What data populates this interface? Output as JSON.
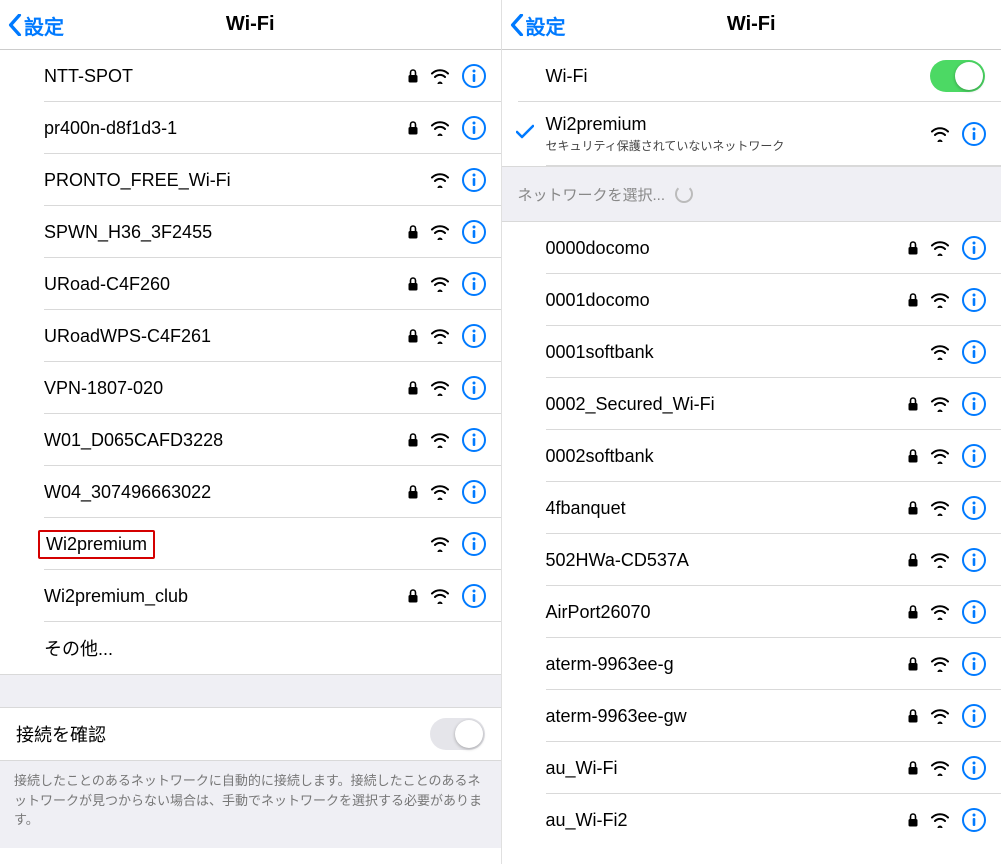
{
  "left": {
    "back_label": "設定",
    "title": "Wi-Fi",
    "networks": [
      {
        "name": "NTT-SPOT",
        "locked": true
      },
      {
        "name": "pr400n-d8f1d3-1",
        "locked": true
      },
      {
        "name": "PRONTO_FREE_Wi-Fi",
        "locked": false
      },
      {
        "name": "SPWN_H36_3F2455",
        "locked": true
      },
      {
        "name": "URoad-C4F260",
        "locked": true
      },
      {
        "name": "URoadWPS-C4F261",
        "locked": true
      },
      {
        "name": "VPN-1807-020",
        "locked": true
      },
      {
        "name": "W01_D065CAFD3228",
        "locked": true
      },
      {
        "name": "W04_307496663022",
        "locked": true
      },
      {
        "name": "Wi2premium",
        "locked": false,
        "highlighted": true
      },
      {
        "name": "Wi2premium_club",
        "locked": true
      },
      {
        "name": "その他...",
        "other": true
      }
    ],
    "ask_to_join_label": "接続を確認",
    "ask_to_join_on": false,
    "footer_text": "接続したことのあるネットワークに自動的に接続します。接続したことのあるネットワークが見つからない場合は、手動でネットワークを選択する必要があります。"
  },
  "right": {
    "back_label": "設定",
    "title": "Wi-Fi",
    "wifi_label": "Wi-Fi",
    "wifi_on": true,
    "connected": {
      "name": "Wi2premium",
      "subtext": "セキュリティ保護されていないネットワーク"
    },
    "choose_label": "ネットワークを選択...",
    "networks": [
      {
        "name": "0000docomo",
        "locked": true
      },
      {
        "name": "0001docomo",
        "locked": true
      },
      {
        "name": "0001softbank",
        "locked": false
      },
      {
        "name": "0002_Secured_Wi-Fi",
        "locked": true
      },
      {
        "name": "0002softbank",
        "locked": true
      },
      {
        "name": "4fbanquet",
        "locked": true
      },
      {
        "name": "502HWa-CD537A",
        "locked": true
      },
      {
        "name": "AirPort26070",
        "locked": true
      },
      {
        "name": "aterm-9963ee-g",
        "locked": true
      },
      {
        "name": "aterm-9963ee-gw",
        "locked": true
      },
      {
        "name": "au_Wi-Fi",
        "locked": true
      },
      {
        "name": "au_Wi-Fi2",
        "locked": true
      }
    ]
  }
}
